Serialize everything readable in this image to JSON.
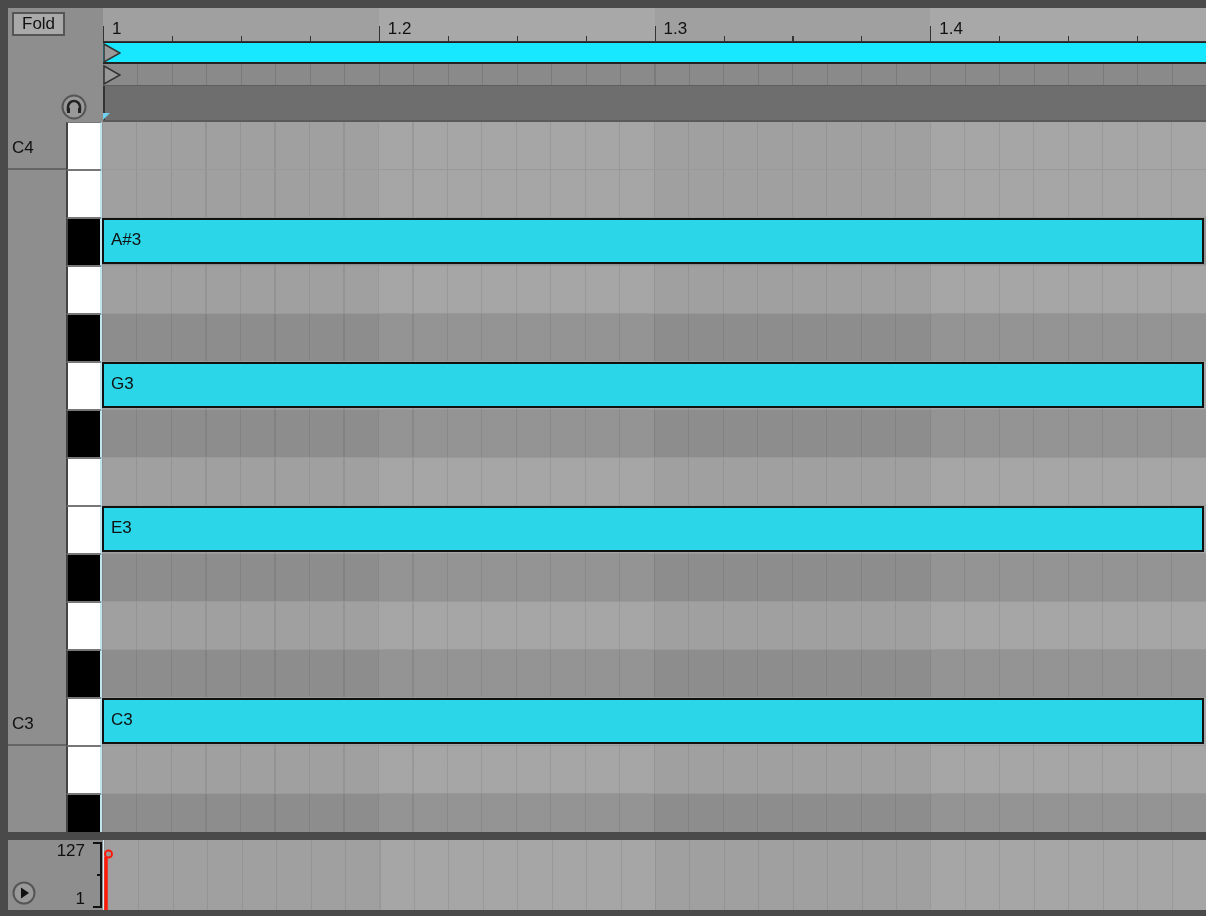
{
  "fold_button": {
    "label": "Fold"
  },
  "ruler": {
    "markers": [
      {
        "label": "1"
      },
      {
        "label": "1.2"
      },
      {
        "label": "1.3"
      },
      {
        "label": "1.4"
      }
    ]
  },
  "keys": [
    {
      "kind": "white",
      "label": "C4"
    },
    {
      "kind": "white"
    },
    {
      "kind": "black",
      "note": {
        "label": "A#3"
      }
    },
    {
      "kind": "white"
    },
    {
      "kind": "black"
    },
    {
      "kind": "white",
      "note": {
        "label": "G3"
      }
    },
    {
      "kind": "black"
    },
    {
      "kind": "white"
    },
    {
      "kind": "white",
      "note": {
        "label": "E3"
      }
    },
    {
      "kind": "black"
    },
    {
      "kind": "white"
    },
    {
      "kind": "black"
    },
    {
      "kind": "white",
      "label": "C3",
      "note": {
        "label": "C3"
      }
    },
    {
      "kind": "white"
    },
    {
      "kind": "black"
    }
  ],
  "velocity_lane": {
    "max": "127",
    "min": "1"
  }
}
